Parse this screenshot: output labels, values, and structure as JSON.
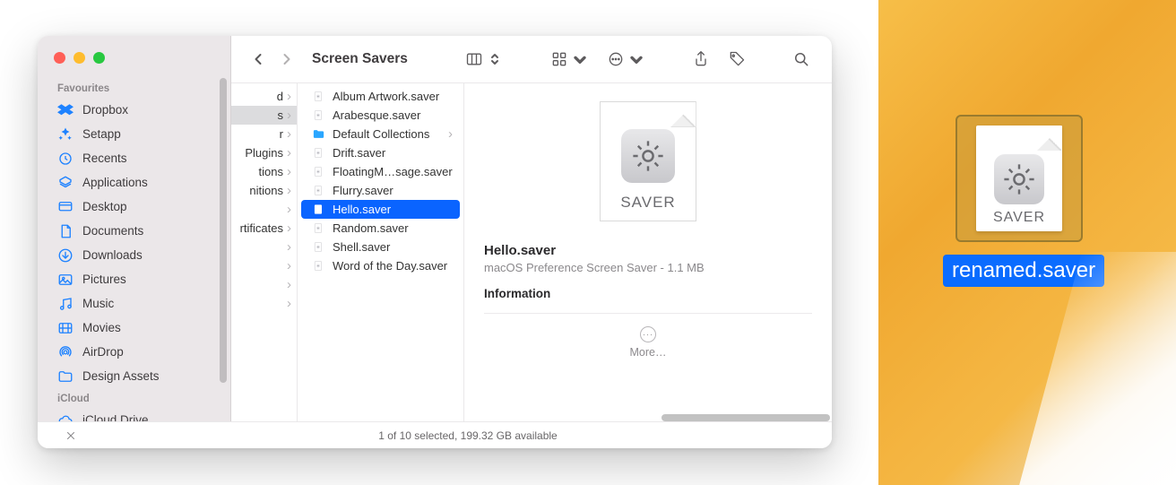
{
  "window": {
    "title": "Screen Savers"
  },
  "sidebar": {
    "sections": [
      {
        "header": "Favourites",
        "items": [
          {
            "label": "Dropbox",
            "icon": "dropbox"
          },
          {
            "label": "Setapp",
            "icon": "setapp"
          },
          {
            "label": "Recents",
            "icon": "clock"
          },
          {
            "label": "Applications",
            "icon": "apps"
          },
          {
            "label": "Desktop",
            "icon": "desktop"
          },
          {
            "label": "Documents",
            "icon": "doc"
          },
          {
            "label": "Downloads",
            "icon": "download"
          },
          {
            "label": "Pictures",
            "icon": "pictures"
          },
          {
            "label": "Music",
            "icon": "music"
          },
          {
            "label": "Movies",
            "icon": "movies"
          },
          {
            "label": "AirDrop",
            "icon": "airdrop"
          },
          {
            "label": "Design Assets",
            "icon": "folder"
          }
        ]
      },
      {
        "header": "iCloud",
        "items": [
          {
            "label": "iCloud Drive",
            "icon": "icloud"
          }
        ]
      }
    ]
  },
  "column_fragments": [
    {
      "text": "d",
      "sel": false
    },
    {
      "text": "s",
      "sel": true
    },
    {
      "text": "r",
      "sel": false
    },
    {
      "text": "Plugins",
      "sel": false
    },
    {
      "text": "tions",
      "sel": false
    },
    {
      "text": "nitions",
      "sel": false
    },
    {
      "text": "",
      "sel": false
    },
    {
      "text": "rtificates",
      "sel": false
    },
    {
      "text": "",
      "sel": false
    },
    {
      "text": "",
      "sel": false
    },
    {
      "text": "",
      "sel": false
    },
    {
      "text": "",
      "sel": false
    }
  ],
  "files": [
    {
      "name": "Album Artwork.saver",
      "type": "saver",
      "sel": false,
      "nav": false
    },
    {
      "name": "Arabesque.saver",
      "type": "saver",
      "sel": false,
      "nav": false
    },
    {
      "name": "Default Collections",
      "type": "folder",
      "sel": false,
      "nav": true
    },
    {
      "name": "Drift.saver",
      "type": "saver",
      "sel": false,
      "nav": false
    },
    {
      "name": "FloatingM…sage.saver",
      "type": "saver",
      "sel": false,
      "nav": false
    },
    {
      "name": "Flurry.saver",
      "type": "saver",
      "sel": false,
      "nav": false
    },
    {
      "name": "Hello.saver",
      "type": "saver",
      "sel": true,
      "nav": false
    },
    {
      "name": "Random.saver",
      "type": "saver",
      "sel": false,
      "nav": false
    },
    {
      "name": "Shell.saver",
      "type": "saver",
      "sel": false,
      "nav": false
    },
    {
      "name": "Word of the Day.saver",
      "type": "saver",
      "sel": false,
      "nav": false
    }
  ],
  "preview": {
    "ext_label": "SAVER",
    "filename": "Hello.saver",
    "subtitle": "macOS Preference Screen Saver - 1.1 MB",
    "info_header": "Information",
    "more_label": "More…"
  },
  "status_bar": "1 of 10 selected, 199.32 GB available",
  "desktop_file": {
    "ext_label": "SAVER",
    "name": "renamed.saver"
  }
}
